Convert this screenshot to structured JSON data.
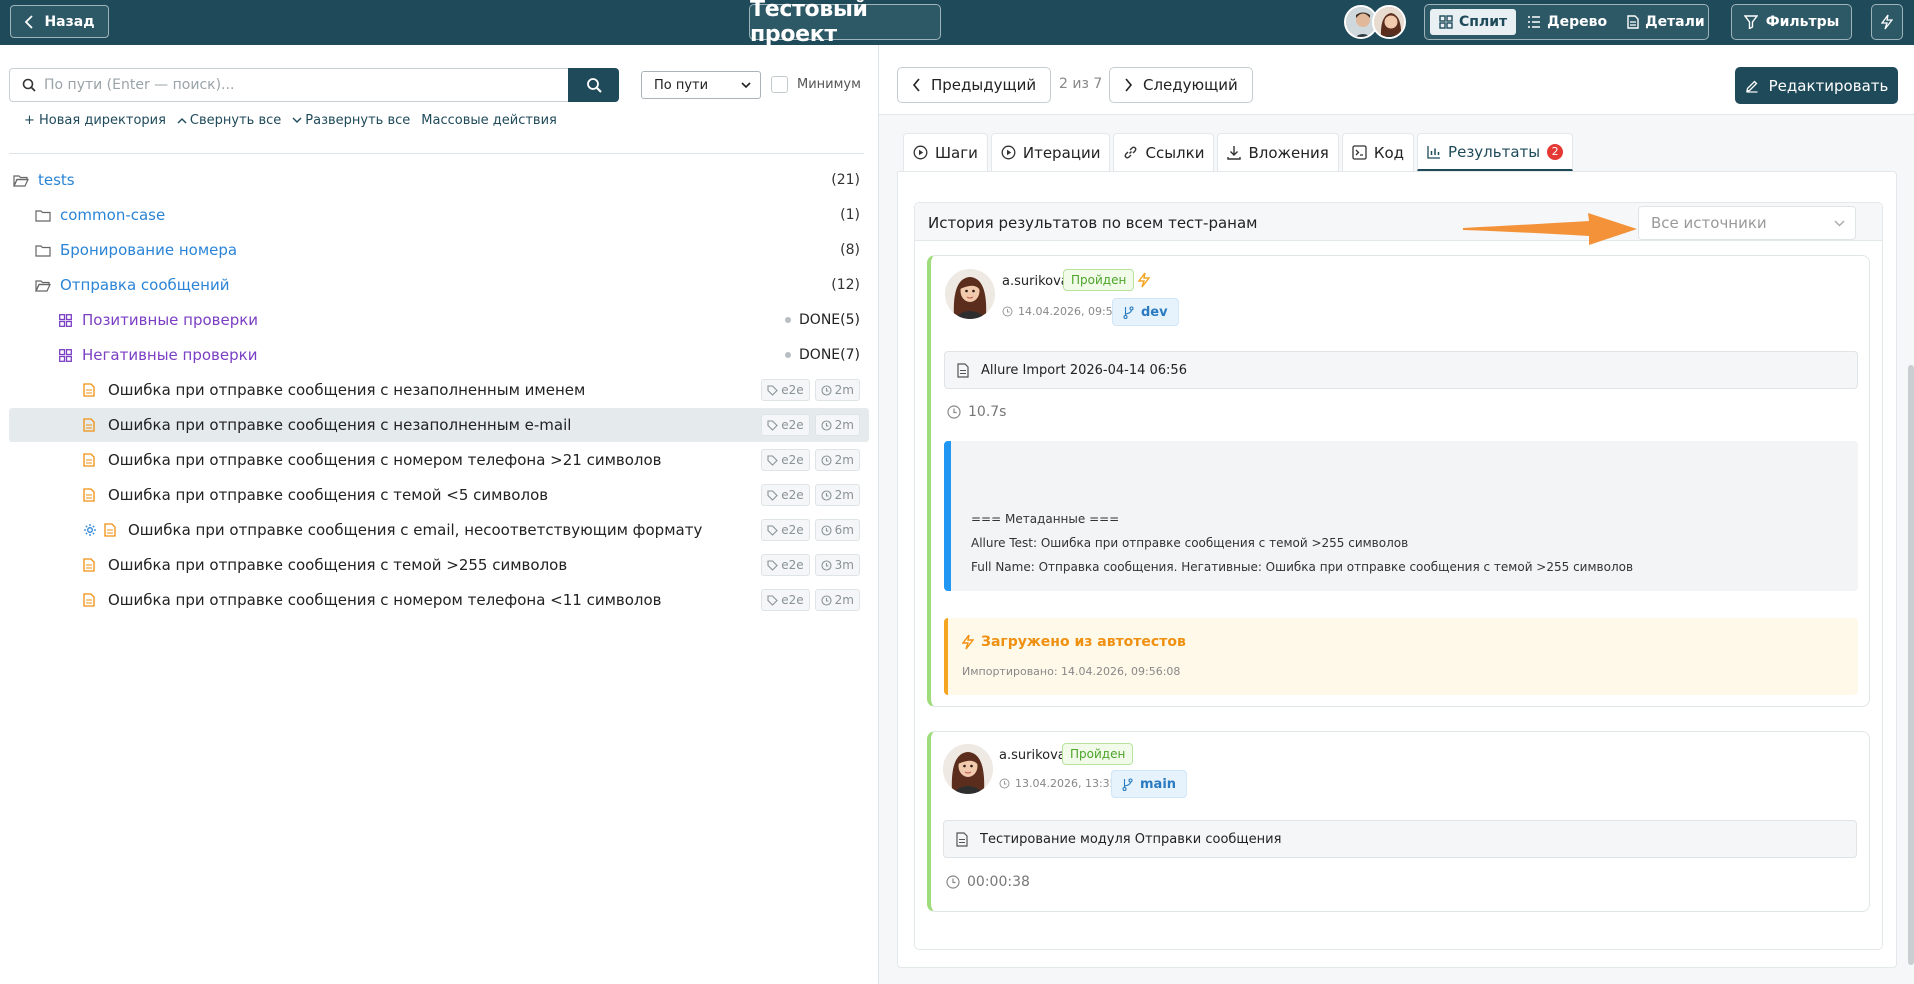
{
  "header": {
    "back_label": "Назад",
    "project_title": "Тестовый проект",
    "views": [
      {
        "label": "Сплит",
        "icon": "grid-icon",
        "active": true
      },
      {
        "label": "Дерево",
        "icon": "list-icon",
        "active": false
      },
      {
        "label": "Детали",
        "icon": "document-icon",
        "active": false
      }
    ],
    "filters_label": "Фильтры"
  },
  "left": {
    "search_placeholder": "По пути (Enter — поиск)...",
    "path_select": "По пути",
    "minimum_label": "Минимум",
    "actions": [
      "+ Новая директория",
      "Свернуть все",
      "Развернуть все",
      "Массовые действия"
    ],
    "tree": [
      {
        "kind": "dir-open",
        "label": "tests",
        "count": "(21)"
      },
      {
        "kind": "dir",
        "label": "common-case",
        "count": "(1)"
      },
      {
        "kind": "dir",
        "label": "Бронирование номера",
        "count": "(8)"
      },
      {
        "kind": "dir-open",
        "label": "Отправка сообщений",
        "count": "(12)"
      },
      {
        "kind": "suite",
        "label": "Позитивные проверки",
        "status": "DONE",
        "count": "(5)"
      },
      {
        "kind": "suite",
        "label": "Негативные проверки",
        "status": "DONE",
        "count": "(7)"
      },
      {
        "kind": "case",
        "label": "Ошибка при отправке сообщения с незаполненным именем",
        "tag": "e2e",
        "time": "2m"
      },
      {
        "kind": "case",
        "label": "Ошибка при отправке сообщения с незаполненным e-mail",
        "tag": "e2e",
        "time": "2m",
        "selected": true
      },
      {
        "kind": "case",
        "label": "Ошибка при отправке сообщения с номером телефона >21 символов",
        "tag": "e2e",
        "time": "2m"
      },
      {
        "kind": "case",
        "label": "Ошибка при отправке сообщения с темой <5 символов",
        "tag": "e2e",
        "time": "2m"
      },
      {
        "kind": "case-auto",
        "label": "Ошибка при отправке сообщения с email, несоответствующим формату",
        "tag": "e2e",
        "time": "6m"
      },
      {
        "kind": "case",
        "label": "Ошибка при отправке сообщения с темой >255 символов",
        "tag": "e2e",
        "time": "3m"
      },
      {
        "kind": "case",
        "label": "Ошибка при отправке сообщения с номером телефона <11 символов",
        "tag": "e2e",
        "time": "2m"
      }
    ]
  },
  "right": {
    "prev_label": "Предыдущий",
    "counter": "2 из 7",
    "next_label": "Следующий",
    "edit_label": "Редактировать",
    "tabs": [
      {
        "label": "Шаги",
        "icon": "play-icon"
      },
      {
        "label": "Итерации",
        "icon": "play-icon"
      },
      {
        "label": "Ссылки",
        "icon": "link-icon"
      },
      {
        "label": "Вложения",
        "icon": "download-icon"
      },
      {
        "label": "Код",
        "icon": "terminal-icon"
      },
      {
        "label": "Результаты",
        "icon": "chart-icon",
        "badge": "2",
        "active": true
      }
    ],
    "history_title": "История результатов по всем тест-ранам",
    "source_placeholder": "Все источники",
    "runs": [
      {
        "user": "a.surikova",
        "status": "Пройден",
        "date": "14.04.2026, 09:56:08",
        "branch": "dev",
        "name": "Allure Import 2026-04-14 06:56",
        "duration": "10.7s",
        "meta_title": "=== Метаданные ===",
        "meta_lines": [
          "Allure Test: Ошибка при отправке сообщения с темой >255 символов",
          "Full Name: Отправка сообщения. Негативные: Ошибка при отправке сообщения с темой >255 символов"
        ],
        "auto_title": "Загружено из автотестов",
        "auto_sub": "Импортировано: 14.04.2026, 09:56:08"
      },
      {
        "user": "a.surikova",
        "status": "Пройден",
        "date": "13.04.2026, 13:35:02",
        "branch": "main",
        "name": "Тестирование модуля Отправки сообщения",
        "duration": "00:00:38"
      }
    ]
  },
  "colors": {
    "primary": "#1f4a5a",
    "link": "#2b84d6",
    "suite": "#7b3fc4",
    "passed": "#4ca42a",
    "arrow": "#f4923a",
    "auto": "#f09010"
  }
}
